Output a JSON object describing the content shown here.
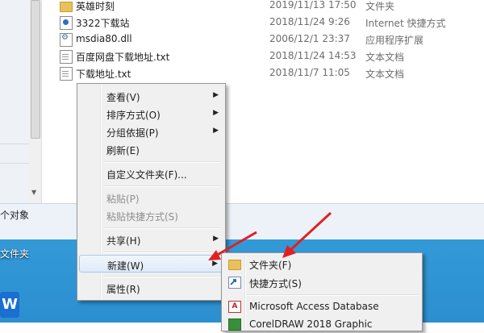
{
  "files": [
    {
      "name": "英雄时刻",
      "date": "2019/11/13 17:50",
      "type": "文件夹",
      "icon": "folder-icon"
    },
    {
      "name": "3322下载站",
      "date": "2018/11/24 9:26",
      "type": "Internet 快捷方式",
      "icon": "internet-shortcut-icon"
    },
    {
      "name": "msdia80.dll",
      "date": "2006/12/1 23:37",
      "type": "应用程序扩展",
      "icon": "dll-file-icon"
    },
    {
      "name": "百度网盘下载地址.txt",
      "date": "2018/11/24 14:53",
      "type": "文本文档",
      "icon": "text-file-icon"
    },
    {
      "name": "下载地址.txt",
      "date": "2018/11/7 11:05",
      "type": "文本文档",
      "icon": "text-file-icon"
    }
  ],
  "status": {
    "item_count": "个对象"
  },
  "desktop": {
    "label": "文件夹",
    "wps_icon": "W"
  },
  "context_menu": {
    "view": "查看(V)",
    "sort": "排序方式(O)",
    "group": "分组依据(P)",
    "refresh": "刷新(E)",
    "customize": "自定义文件夹(F)...",
    "paste": "粘贴(P)",
    "paste_shortcut": "粘贴快捷方式(S)",
    "share": "共享(H)",
    "new": "新建(W)",
    "properties": "属性(R)"
  },
  "submenu": {
    "folder": "文件夹(F)",
    "shortcut": "快捷方式(S)",
    "access": "Microsoft Access Database",
    "coreldraw": "CorelDRAW 2018 Graphic"
  },
  "colors": {
    "arrow": "#e02020",
    "highlight": "#dfeaf8"
  }
}
